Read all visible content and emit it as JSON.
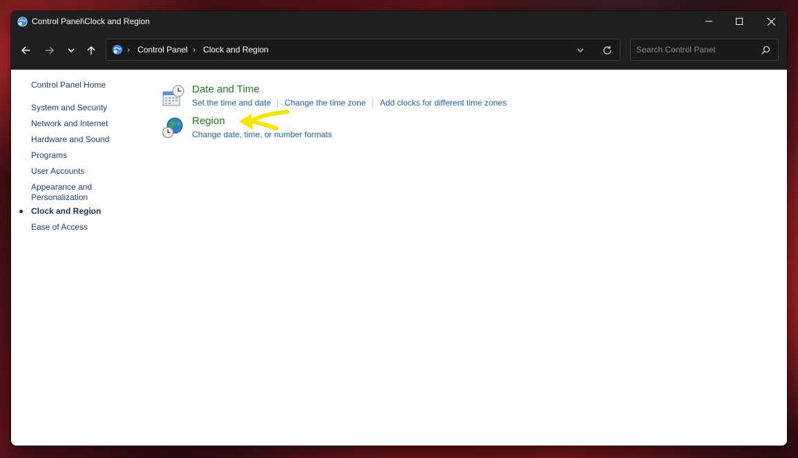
{
  "window": {
    "title": "Control Panel\\Clock and Region"
  },
  "nav": {
    "crumbs": [
      "Control Panel",
      "Clock and Region"
    ],
    "search_placeholder": "Search Control Panel"
  },
  "sidebar": {
    "home": "Control Panel Home",
    "items": [
      {
        "label": "System and Security"
      },
      {
        "label": "Network and Internet"
      },
      {
        "label": "Hardware and Sound"
      },
      {
        "label": "Programs"
      },
      {
        "label": "User Accounts"
      },
      {
        "label": "Appearance and Personalization"
      },
      {
        "label": "Clock and Region",
        "active": true
      },
      {
        "label": "Ease of Access"
      }
    ]
  },
  "categories": [
    {
      "title": "Date and Time",
      "icon": "calendar-clock-icon",
      "tasks": [
        "Set the time and date",
        "Change the time zone",
        "Add clocks for different time zones"
      ]
    },
    {
      "title": "Region",
      "icon": "globe-clock-icon",
      "tasks": [
        "Change date, time, or number formats"
      ]
    }
  ],
  "annotation": {
    "type": "yellow-arrow",
    "color": "#f5e400",
    "points_to": "Region"
  },
  "colors": {
    "titlebar": "#1f1f1f",
    "category_title": "#1d7a1d",
    "task_link": "#1b5fa8",
    "sidebar_link": "#1e3e6a"
  }
}
